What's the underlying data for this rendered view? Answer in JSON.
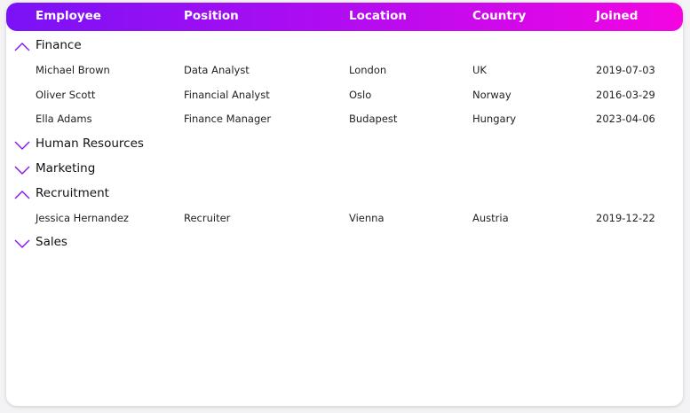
{
  "columns": [
    "Employee",
    "Position",
    "Location",
    "Country",
    "Joined"
  ],
  "accent": "#8a12f0",
  "groups": [
    {
      "name": "Finance",
      "expanded": true,
      "rows": [
        [
          "Michael Brown",
          "Data Analyst",
          "London",
          "UK",
          "2019-07-03"
        ],
        [
          "Oliver Scott",
          "Financial Analyst",
          "Oslo",
          "Norway",
          "2016-03-29"
        ],
        [
          "Ella Adams",
          "Finance Manager",
          "Budapest",
          "Hungary",
          "2023-04-06"
        ]
      ]
    },
    {
      "name": "Human Resources",
      "expanded": false,
      "rows": []
    },
    {
      "name": "Marketing",
      "expanded": false,
      "rows": []
    },
    {
      "name": "Recruitment",
      "expanded": true,
      "rows": [
        [
          "Jessica Hernandez",
          "Recruiter",
          "Vienna",
          "Austria",
          "2019-12-22"
        ]
      ]
    },
    {
      "name": "Sales",
      "expanded": false,
      "rows": []
    }
  ]
}
